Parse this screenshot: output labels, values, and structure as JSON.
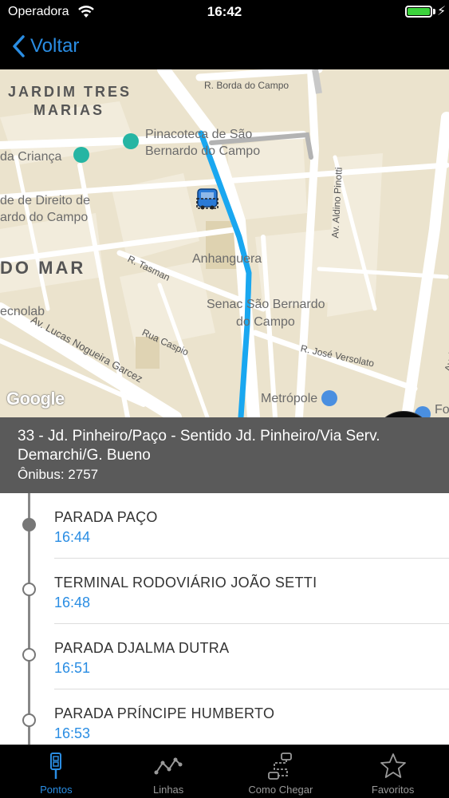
{
  "status_bar": {
    "carrier": "Operadora",
    "time": "16:42"
  },
  "nav": {
    "back_label": "Voltar"
  },
  "map": {
    "labels": {
      "jardim_tres": "JARDIM TRES",
      "marias": "MARIAS",
      "r_borda_do_campo": "R. Borda do Campo",
      "pinacoteca_1": "Pinacoteca de São",
      "pinacoteca_2": "Bernardo do Campo",
      "da_crianca": "da Criança",
      "direito_1": "de de Direito de",
      "direito_2": "ardo do Campo",
      "do_mar": "DO MAR",
      "anhanguera": "Anhanguera",
      "r_tasman": "R. Tasman",
      "senac_1": "Senac São Bernardo",
      "senac_2": "do Campo",
      "ecnolab": "ecnolab",
      "rua_caspio": "Rua Caspio",
      "av_lucas": "Av. Lucas Nogueira Garcez",
      "r_jose": "R. José Versolato",
      "av_aldino": "Av. Aldino Pinotti",
      "av_pereira": "Av. Pereira Barreto",
      "metropole": "Metrópole",
      "fo": "Fo"
    },
    "google_logo": "Google",
    "route_color": "#19a7f0",
    "map_background": "#ebe3cd"
  },
  "route": {
    "title": "33 - Jd. Pinheiro/Paço - Sentido Jd. Pinheiro/Via Serv. Demarchi/G. Bueno",
    "bus": "Ônibus: 2757"
  },
  "stops": [
    {
      "name": "PARADA PAÇO",
      "time": "16:44",
      "current": true
    },
    {
      "name": "TERMINAL RODOVIÁRIO JOÃO SETTI",
      "time": "16:48",
      "current": false
    },
    {
      "name": "PARADA DJALMA DUTRA",
      "time": "16:51",
      "current": false
    },
    {
      "name": "PARADA PRÍNCIPE HUMBERTO",
      "time": "16:53",
      "current": false
    }
  ],
  "tabs": [
    {
      "label": "Pontos",
      "icon": "bus-stop-icon",
      "active": true
    },
    {
      "label": "Linhas",
      "icon": "route-line-icon",
      "active": false
    },
    {
      "label": "Como Chegar",
      "icon": "directions-icon",
      "active": false
    },
    {
      "label": "Favoritos",
      "icon": "star-icon",
      "active": false
    }
  ],
  "colors": {
    "accent": "#2a8de3",
    "panel": "#5a5a5a",
    "battery": "#3cd33c"
  }
}
